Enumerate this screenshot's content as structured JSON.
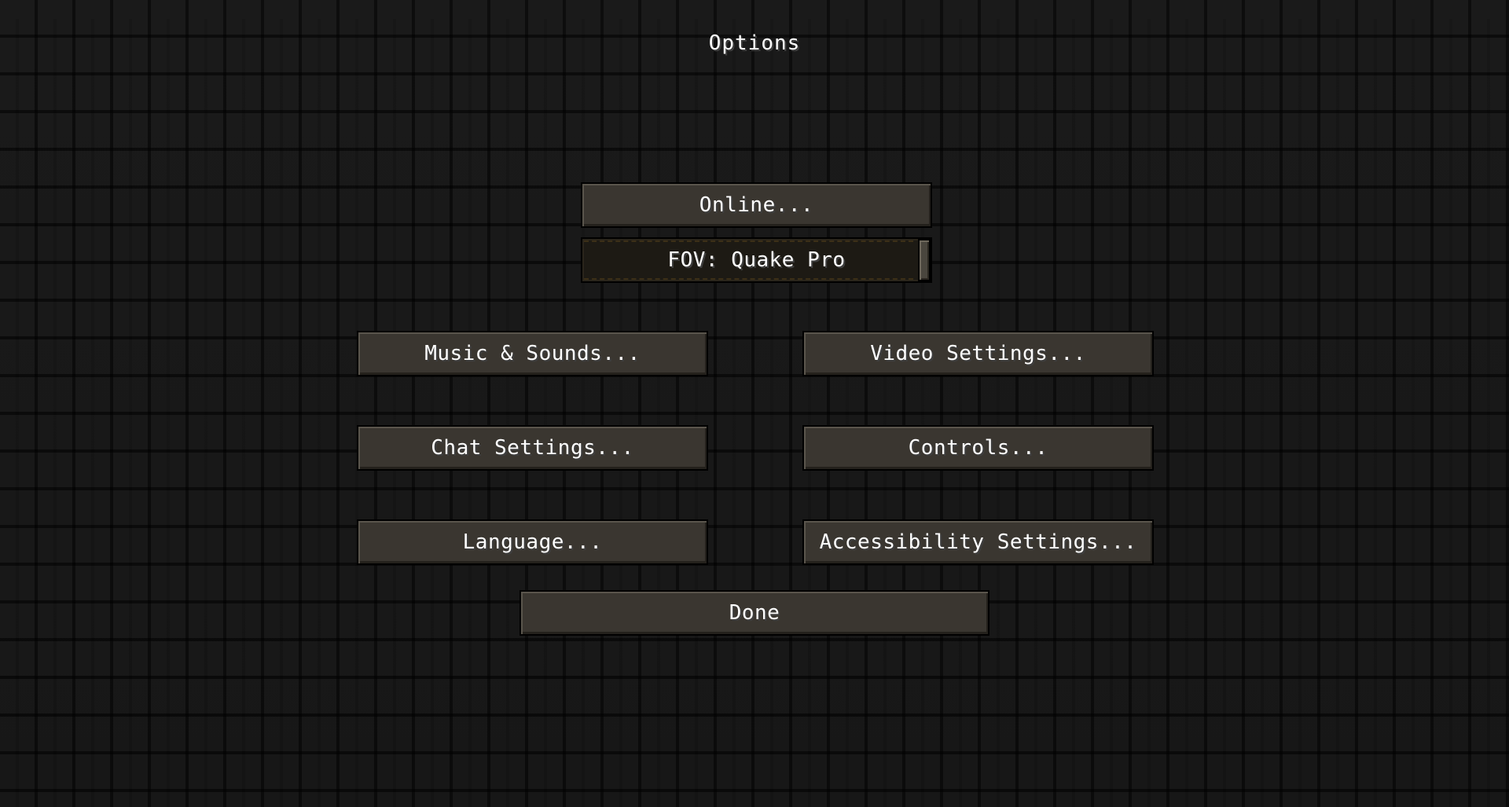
{
  "screen": {
    "title": "Options"
  },
  "buttons": {
    "online": "Online...",
    "music_sounds": "Music & Sounds...",
    "video_settings": "Video Settings...",
    "chat_settings": "Chat Settings...",
    "controls": "Controls...",
    "language": "Language...",
    "accessibility": "Accessibility Settings...",
    "done": "Done"
  },
  "fov_slider": {
    "label": "FOV: Quake Pro",
    "value_fraction": 1.0
  },
  "colors": {
    "button_face": "#3a3630",
    "slider_track": "#1d1a14",
    "text": "#ffffff",
    "background": "#121212"
  }
}
